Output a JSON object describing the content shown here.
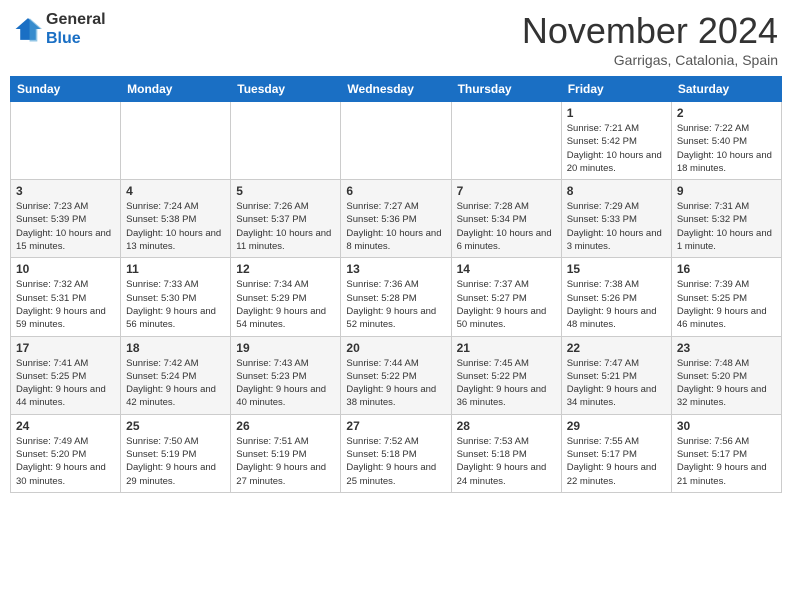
{
  "header": {
    "logo_general": "General",
    "logo_blue": "Blue",
    "month_title": "November 2024",
    "location": "Garrigas, Catalonia, Spain"
  },
  "weekdays": [
    "Sunday",
    "Monday",
    "Tuesday",
    "Wednesday",
    "Thursday",
    "Friday",
    "Saturday"
  ],
  "weeks": [
    [
      {
        "day": "",
        "info": ""
      },
      {
        "day": "",
        "info": ""
      },
      {
        "day": "",
        "info": ""
      },
      {
        "day": "",
        "info": ""
      },
      {
        "day": "",
        "info": ""
      },
      {
        "day": "1",
        "info": "Sunrise: 7:21 AM\nSunset: 5:42 PM\nDaylight: 10 hours and 20 minutes."
      },
      {
        "day": "2",
        "info": "Sunrise: 7:22 AM\nSunset: 5:40 PM\nDaylight: 10 hours and 18 minutes."
      }
    ],
    [
      {
        "day": "3",
        "info": "Sunrise: 7:23 AM\nSunset: 5:39 PM\nDaylight: 10 hours and 15 minutes."
      },
      {
        "day": "4",
        "info": "Sunrise: 7:24 AM\nSunset: 5:38 PM\nDaylight: 10 hours and 13 minutes."
      },
      {
        "day": "5",
        "info": "Sunrise: 7:26 AM\nSunset: 5:37 PM\nDaylight: 10 hours and 11 minutes."
      },
      {
        "day": "6",
        "info": "Sunrise: 7:27 AM\nSunset: 5:36 PM\nDaylight: 10 hours and 8 minutes."
      },
      {
        "day": "7",
        "info": "Sunrise: 7:28 AM\nSunset: 5:34 PM\nDaylight: 10 hours and 6 minutes."
      },
      {
        "day": "8",
        "info": "Sunrise: 7:29 AM\nSunset: 5:33 PM\nDaylight: 10 hours and 3 minutes."
      },
      {
        "day": "9",
        "info": "Sunrise: 7:31 AM\nSunset: 5:32 PM\nDaylight: 10 hours and 1 minute."
      }
    ],
    [
      {
        "day": "10",
        "info": "Sunrise: 7:32 AM\nSunset: 5:31 PM\nDaylight: 9 hours and 59 minutes."
      },
      {
        "day": "11",
        "info": "Sunrise: 7:33 AM\nSunset: 5:30 PM\nDaylight: 9 hours and 56 minutes."
      },
      {
        "day": "12",
        "info": "Sunrise: 7:34 AM\nSunset: 5:29 PM\nDaylight: 9 hours and 54 minutes."
      },
      {
        "day": "13",
        "info": "Sunrise: 7:36 AM\nSunset: 5:28 PM\nDaylight: 9 hours and 52 minutes."
      },
      {
        "day": "14",
        "info": "Sunrise: 7:37 AM\nSunset: 5:27 PM\nDaylight: 9 hours and 50 minutes."
      },
      {
        "day": "15",
        "info": "Sunrise: 7:38 AM\nSunset: 5:26 PM\nDaylight: 9 hours and 48 minutes."
      },
      {
        "day": "16",
        "info": "Sunrise: 7:39 AM\nSunset: 5:25 PM\nDaylight: 9 hours and 46 minutes."
      }
    ],
    [
      {
        "day": "17",
        "info": "Sunrise: 7:41 AM\nSunset: 5:25 PM\nDaylight: 9 hours and 44 minutes."
      },
      {
        "day": "18",
        "info": "Sunrise: 7:42 AM\nSunset: 5:24 PM\nDaylight: 9 hours and 42 minutes."
      },
      {
        "day": "19",
        "info": "Sunrise: 7:43 AM\nSunset: 5:23 PM\nDaylight: 9 hours and 40 minutes."
      },
      {
        "day": "20",
        "info": "Sunrise: 7:44 AM\nSunset: 5:22 PM\nDaylight: 9 hours and 38 minutes."
      },
      {
        "day": "21",
        "info": "Sunrise: 7:45 AM\nSunset: 5:22 PM\nDaylight: 9 hours and 36 minutes."
      },
      {
        "day": "22",
        "info": "Sunrise: 7:47 AM\nSunset: 5:21 PM\nDaylight: 9 hours and 34 minutes."
      },
      {
        "day": "23",
        "info": "Sunrise: 7:48 AM\nSunset: 5:20 PM\nDaylight: 9 hours and 32 minutes."
      }
    ],
    [
      {
        "day": "24",
        "info": "Sunrise: 7:49 AM\nSunset: 5:20 PM\nDaylight: 9 hours and 30 minutes."
      },
      {
        "day": "25",
        "info": "Sunrise: 7:50 AM\nSunset: 5:19 PM\nDaylight: 9 hours and 29 minutes."
      },
      {
        "day": "26",
        "info": "Sunrise: 7:51 AM\nSunset: 5:19 PM\nDaylight: 9 hours and 27 minutes."
      },
      {
        "day": "27",
        "info": "Sunrise: 7:52 AM\nSunset: 5:18 PM\nDaylight: 9 hours and 25 minutes."
      },
      {
        "day": "28",
        "info": "Sunrise: 7:53 AM\nSunset: 5:18 PM\nDaylight: 9 hours and 24 minutes."
      },
      {
        "day": "29",
        "info": "Sunrise: 7:55 AM\nSunset: 5:17 PM\nDaylight: 9 hours and 22 minutes."
      },
      {
        "day": "30",
        "info": "Sunrise: 7:56 AM\nSunset: 5:17 PM\nDaylight: 9 hours and 21 minutes."
      }
    ]
  ]
}
